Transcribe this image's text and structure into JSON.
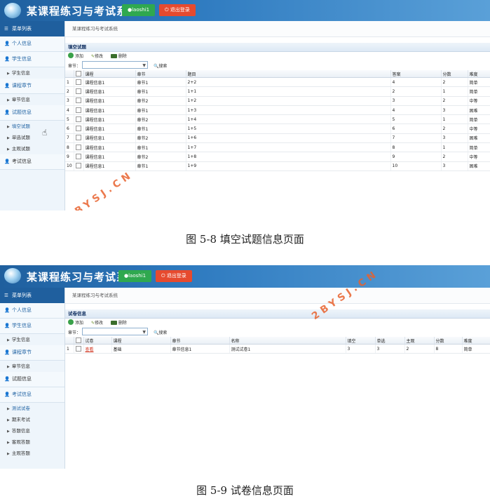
{
  "app": {
    "title": "某课程练习与考试系统",
    "user_label": "laoshi1",
    "logout_label": "退出登录"
  },
  "watermark": "2BYSJ.CN",
  "shot1": {
    "menu_header": "菜单列表",
    "breadcrumb": "某课程练习与考试系统",
    "menu": [
      {
        "label": "个人信息",
        "type": "group"
      },
      {
        "label": "学生信息",
        "type": "group"
      },
      {
        "label": "学生信息",
        "type": "sub"
      },
      {
        "label": "课程章节",
        "type": "group"
      },
      {
        "label": "章节信息",
        "type": "sub"
      },
      {
        "label": "试题信息",
        "type": "group"
      },
      {
        "label": "填空试题",
        "type": "sub",
        "active": true
      },
      {
        "label": "单选试题",
        "type": "sub"
      },
      {
        "label": "主观试题",
        "type": "sub"
      },
      {
        "label": "考试信息",
        "type": "group",
        "dark": true
      }
    ],
    "panel_title": "填空试题",
    "toolbar": {
      "add": "添加",
      "edit": "修改",
      "delete": "删除"
    },
    "search": {
      "label": "章节：",
      "button": "搜索"
    },
    "columns": [
      "课程",
      "章节",
      "题目",
      "答案",
      "分数",
      "难度"
    ],
    "rows": [
      [
        "1",
        "课程信息1",
        "章节1",
        "2+2",
        "4",
        "2",
        "简单"
      ],
      [
        "2",
        "课程信息1",
        "章节1",
        "1+1",
        "2",
        "1",
        "简单"
      ],
      [
        "3",
        "课程信息1",
        "章节2",
        "1+2",
        "3",
        "2",
        "中等"
      ],
      [
        "4",
        "课程信息1",
        "章节1",
        "1+3",
        "4",
        "3",
        "困难"
      ],
      [
        "5",
        "课程信息1",
        "章节2",
        "1+4",
        "5",
        "1",
        "简单"
      ],
      [
        "6",
        "课程信息1",
        "章节1",
        "1+5",
        "6",
        "2",
        "中等"
      ],
      [
        "7",
        "课程信息1",
        "章节2",
        "1+6",
        "7",
        "3",
        "困难"
      ],
      [
        "8",
        "课程信息1",
        "章节1",
        "1+7",
        "8",
        "1",
        "简单"
      ],
      [
        "9",
        "课程信息1",
        "章节2",
        "1+8",
        "9",
        "2",
        "中等"
      ],
      [
        "10",
        "课程信息1",
        "章节1",
        "1+9",
        "10",
        "3",
        "困难"
      ]
    ]
  },
  "caption1": "图 5-8 填空试题信息页面",
  "shot2": {
    "menu_header": "菜单列表",
    "breadcrumb": "某课程练习与考试系统",
    "menu": [
      {
        "label": "个人信息",
        "type": "group"
      },
      {
        "label": "学生信息",
        "type": "group"
      },
      {
        "label": "学生信息",
        "type": "sub"
      },
      {
        "label": "课程章节",
        "type": "group"
      },
      {
        "label": "章节信息",
        "type": "sub"
      },
      {
        "label": "试题信息",
        "type": "group",
        "dark": true
      },
      {
        "label": "考试信息",
        "type": "group"
      },
      {
        "label": "测试试卷",
        "type": "sub",
        "active": true
      },
      {
        "label": "期末考试",
        "type": "sub"
      },
      {
        "label": "答题信息",
        "type": "sub"
      },
      {
        "label": "客观答题",
        "type": "sub"
      },
      {
        "label": "主观答题",
        "type": "sub"
      }
    ],
    "panel_title": "试卷信息",
    "toolbar": {
      "add": "添加",
      "edit": "修改",
      "delete": "删除"
    },
    "search": {
      "label": "章节：",
      "button": "搜索"
    },
    "columns": [
      "试卷",
      "课程",
      "章节",
      "名称",
      "填空",
      "单选",
      "主观",
      "分数",
      "难度"
    ],
    "rows": [
      [
        "1",
        "查看",
        "基础",
        "章节信息1",
        "测试试卷1",
        "3",
        "3",
        "2",
        "8",
        "简单"
      ]
    ]
  },
  "caption2": "图 5-9 试卷信息页面",
  "colors": {
    "header_blue": "#2f7bc0",
    "user_green": "#2fa84f",
    "logout_red": "#e64a2e",
    "watermark": "#e8622e"
  },
  "icons": [
    "app-logo-icon",
    "person-icon",
    "list-icon",
    "add-icon",
    "edit-icon",
    "delete-icon",
    "search-icon",
    "power-icon",
    "cursor-hand-icon"
  ]
}
